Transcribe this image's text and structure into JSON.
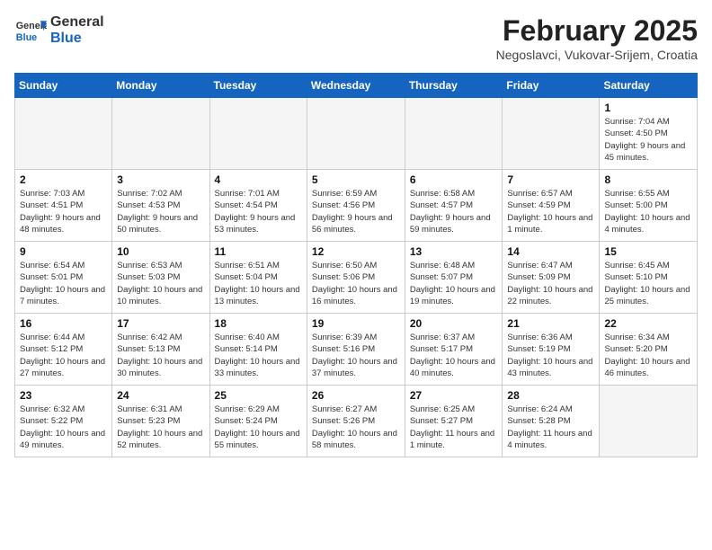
{
  "header": {
    "logo_general": "General",
    "logo_blue": "Blue",
    "month_year": "February 2025",
    "location": "Negoslavci, Vukovar-Srijem, Croatia"
  },
  "weekdays": [
    "Sunday",
    "Monday",
    "Tuesday",
    "Wednesday",
    "Thursday",
    "Friday",
    "Saturday"
  ],
  "weeks": [
    [
      {
        "day": "",
        "info": ""
      },
      {
        "day": "",
        "info": ""
      },
      {
        "day": "",
        "info": ""
      },
      {
        "day": "",
        "info": ""
      },
      {
        "day": "",
        "info": ""
      },
      {
        "day": "",
        "info": ""
      },
      {
        "day": "1",
        "info": "Sunrise: 7:04 AM\nSunset: 4:50 PM\nDaylight: 9 hours and 45 minutes."
      }
    ],
    [
      {
        "day": "2",
        "info": "Sunrise: 7:03 AM\nSunset: 4:51 PM\nDaylight: 9 hours and 48 minutes."
      },
      {
        "day": "3",
        "info": "Sunrise: 7:02 AM\nSunset: 4:53 PM\nDaylight: 9 hours and 50 minutes."
      },
      {
        "day": "4",
        "info": "Sunrise: 7:01 AM\nSunset: 4:54 PM\nDaylight: 9 hours and 53 minutes."
      },
      {
        "day": "5",
        "info": "Sunrise: 6:59 AM\nSunset: 4:56 PM\nDaylight: 9 hours and 56 minutes."
      },
      {
        "day": "6",
        "info": "Sunrise: 6:58 AM\nSunset: 4:57 PM\nDaylight: 9 hours and 59 minutes."
      },
      {
        "day": "7",
        "info": "Sunrise: 6:57 AM\nSunset: 4:59 PM\nDaylight: 10 hours and 1 minute."
      },
      {
        "day": "8",
        "info": "Sunrise: 6:55 AM\nSunset: 5:00 PM\nDaylight: 10 hours and 4 minutes."
      }
    ],
    [
      {
        "day": "9",
        "info": "Sunrise: 6:54 AM\nSunset: 5:01 PM\nDaylight: 10 hours and 7 minutes."
      },
      {
        "day": "10",
        "info": "Sunrise: 6:53 AM\nSunset: 5:03 PM\nDaylight: 10 hours and 10 minutes."
      },
      {
        "day": "11",
        "info": "Sunrise: 6:51 AM\nSunset: 5:04 PM\nDaylight: 10 hours and 13 minutes."
      },
      {
        "day": "12",
        "info": "Sunrise: 6:50 AM\nSunset: 5:06 PM\nDaylight: 10 hours and 16 minutes."
      },
      {
        "day": "13",
        "info": "Sunrise: 6:48 AM\nSunset: 5:07 PM\nDaylight: 10 hours and 19 minutes."
      },
      {
        "day": "14",
        "info": "Sunrise: 6:47 AM\nSunset: 5:09 PM\nDaylight: 10 hours and 22 minutes."
      },
      {
        "day": "15",
        "info": "Sunrise: 6:45 AM\nSunset: 5:10 PM\nDaylight: 10 hours and 25 minutes."
      }
    ],
    [
      {
        "day": "16",
        "info": "Sunrise: 6:44 AM\nSunset: 5:12 PM\nDaylight: 10 hours and 27 minutes."
      },
      {
        "day": "17",
        "info": "Sunrise: 6:42 AM\nSunset: 5:13 PM\nDaylight: 10 hours and 30 minutes."
      },
      {
        "day": "18",
        "info": "Sunrise: 6:40 AM\nSunset: 5:14 PM\nDaylight: 10 hours and 33 minutes."
      },
      {
        "day": "19",
        "info": "Sunrise: 6:39 AM\nSunset: 5:16 PM\nDaylight: 10 hours and 37 minutes."
      },
      {
        "day": "20",
        "info": "Sunrise: 6:37 AM\nSunset: 5:17 PM\nDaylight: 10 hours and 40 minutes."
      },
      {
        "day": "21",
        "info": "Sunrise: 6:36 AM\nSunset: 5:19 PM\nDaylight: 10 hours and 43 minutes."
      },
      {
        "day": "22",
        "info": "Sunrise: 6:34 AM\nSunset: 5:20 PM\nDaylight: 10 hours and 46 minutes."
      }
    ],
    [
      {
        "day": "23",
        "info": "Sunrise: 6:32 AM\nSunset: 5:22 PM\nDaylight: 10 hours and 49 minutes."
      },
      {
        "day": "24",
        "info": "Sunrise: 6:31 AM\nSunset: 5:23 PM\nDaylight: 10 hours and 52 minutes."
      },
      {
        "day": "25",
        "info": "Sunrise: 6:29 AM\nSunset: 5:24 PM\nDaylight: 10 hours and 55 minutes."
      },
      {
        "day": "26",
        "info": "Sunrise: 6:27 AM\nSunset: 5:26 PM\nDaylight: 10 hours and 58 minutes."
      },
      {
        "day": "27",
        "info": "Sunrise: 6:25 AM\nSunset: 5:27 PM\nDaylight: 11 hours and 1 minute."
      },
      {
        "day": "28",
        "info": "Sunrise: 6:24 AM\nSunset: 5:28 PM\nDaylight: 11 hours and 4 minutes."
      },
      {
        "day": "",
        "info": ""
      }
    ]
  ]
}
